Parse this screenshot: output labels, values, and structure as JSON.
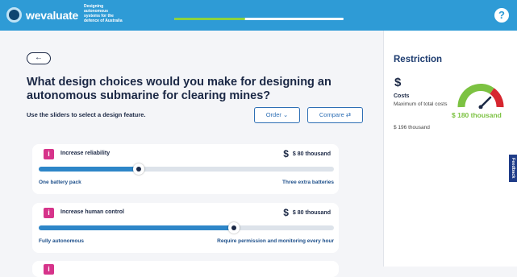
{
  "header": {
    "logo_text": "wevaluate",
    "tagline": [
      "Designing",
      "autonomous",
      "systems for the",
      "defence of Australia"
    ],
    "progress": 0.42,
    "help_icon": "help-icon"
  },
  "main": {
    "back_label": "←",
    "question": "What design choices would you make for designing an autonomous submarine for clearing mines?",
    "instruction": "Use the sliders to select a design feature.",
    "order_label": "Order ⌄",
    "compare_label": "Compare ⇄",
    "features": [
      {
        "label": "Increase reliability",
        "cost": "$ 80 thousand",
        "min": "One battery pack",
        "max": "Three extra batteries",
        "value": 0.34
      },
      {
        "label": "Increase human control",
        "cost": "$ 80 thousand",
        "min": "Fully autonomous",
        "max": "Require permission and monitoring every hour",
        "value": 0.66
      }
    ]
  },
  "restriction": {
    "title": "Restriction",
    "icon": "$",
    "costs_label": "Costs",
    "description": "Maximum of total costs",
    "current_value": "$ 196 thousand",
    "gauge_label": "$ 180 thousand"
  },
  "feedback_label": "Feedback",
  "colors": {
    "header": "#2e9bd6",
    "accent": "#d6338a",
    "slider": "#2e86c8",
    "gauge_green": "#7cc242",
    "gauge_red": "#d6262f"
  }
}
